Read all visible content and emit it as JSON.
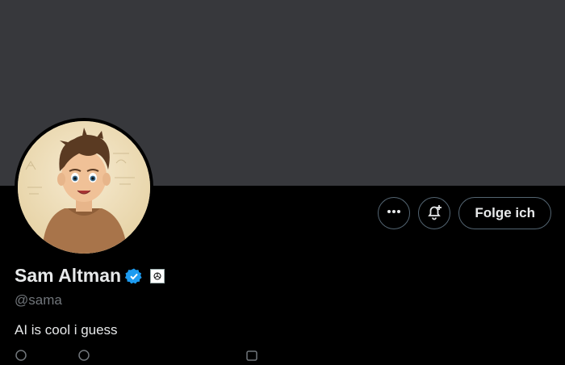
{
  "profile": {
    "name": "Sam Altman",
    "handle": "@sama",
    "bio": "AI is cool i guess"
  },
  "actions": {
    "follow_label": "Folge ich"
  },
  "icons": {
    "more": "more-icon",
    "notifications": "bell-plus-icon",
    "verified": "verified-badge-icon",
    "affiliation": "openai-logo-icon"
  },
  "colors": {
    "banner": "#37383c",
    "verified": "#1d9bf0",
    "background": "#000000",
    "muted_text": "#71767b"
  }
}
